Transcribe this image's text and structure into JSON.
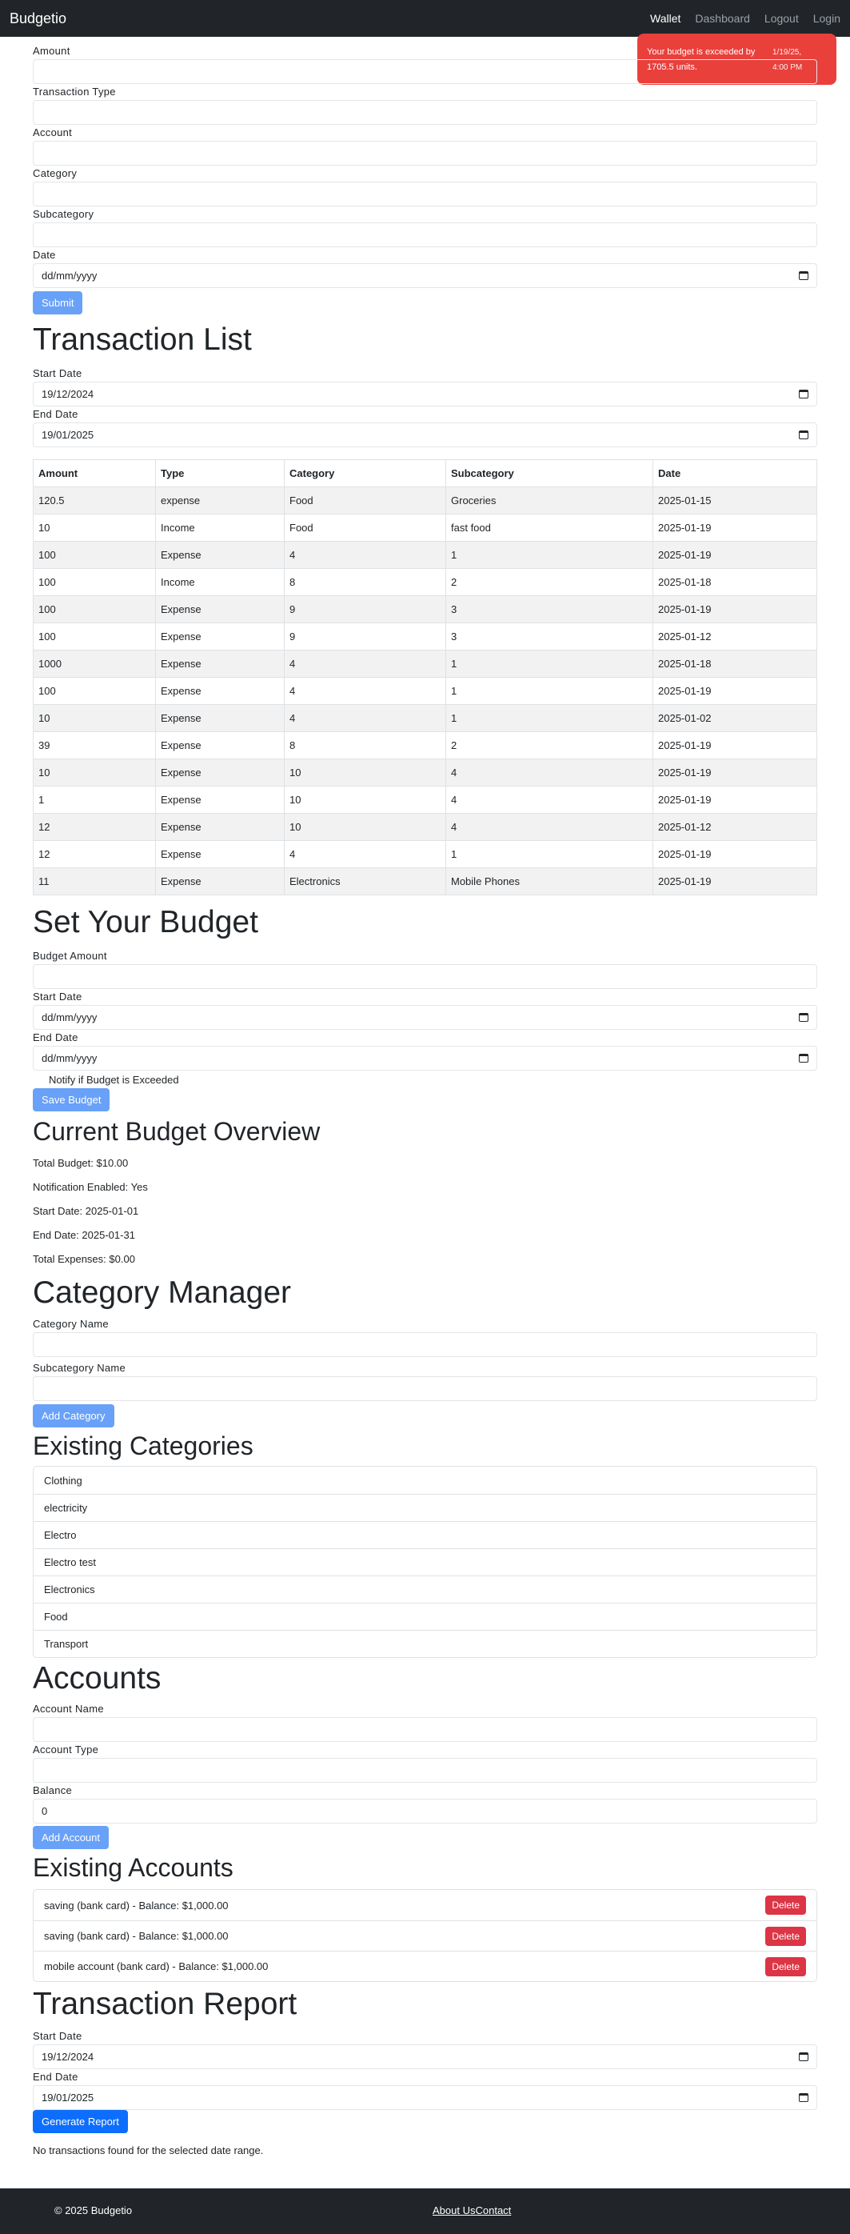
{
  "nav": {
    "brand": "Budgetio",
    "items": [
      "Wallet",
      "Dashboard",
      "Logout",
      "Login"
    ]
  },
  "toast": {
    "message": "Your budget is exceeded by 1705.5 units.",
    "time": "1/19/25, 4:00 PM"
  },
  "transaction_form": {
    "amount_label": "Amount",
    "type_label": "Transaction Type",
    "account_label": "Account",
    "category_label": "Category",
    "subcategory_label": "Subcategory",
    "date_label": "Date",
    "date_placeholder": "dd/mm/yyyy",
    "submit_label": "Submit"
  },
  "transaction_list": {
    "title": "Transaction List",
    "start_label": "Start Date",
    "start_value": "19/12/2024",
    "end_label": "End Date",
    "end_value": "19/01/2025",
    "headers": [
      "Amount",
      "Type",
      "Category",
      "Subcategory",
      "Date"
    ],
    "rows": [
      [
        "120.5",
        "expense",
        "Food",
        "Groceries",
        "2025-01-15"
      ],
      [
        "10",
        "Income",
        "Food",
        "fast food",
        "2025-01-19"
      ],
      [
        "100",
        "Expense",
        "4",
        "1",
        "2025-01-19"
      ],
      [
        "100",
        "Income",
        "8",
        "2",
        "2025-01-18"
      ],
      [
        "100",
        "Expense",
        "9",
        "3",
        "2025-01-19"
      ],
      [
        "100",
        "Expense",
        "9",
        "3",
        "2025-01-12"
      ],
      [
        "1000",
        "Expense",
        "4",
        "1",
        "2025-01-18"
      ],
      [
        "100",
        "Expense",
        "4",
        "1",
        "2025-01-19"
      ],
      [
        "10",
        "Expense",
        "4",
        "1",
        "2025-01-02"
      ],
      [
        "39",
        "Expense",
        "8",
        "2",
        "2025-01-19"
      ],
      [
        "10",
        "Expense",
        "10",
        "4",
        "2025-01-19"
      ],
      [
        "1",
        "Expense",
        "10",
        "4",
        "2025-01-19"
      ],
      [
        "12",
        "Expense",
        "10",
        "4",
        "2025-01-12"
      ],
      [
        "12",
        "Expense",
        "4",
        "1",
        "2025-01-19"
      ],
      [
        "11",
        "Expense",
        "Electronics",
        "Mobile Phones",
        "2025-01-19"
      ]
    ]
  },
  "budget": {
    "title": "Set Your Budget",
    "amount_label": "Budget Amount",
    "start_label": "Start Date",
    "end_label": "End Date",
    "date_placeholder": "dd/mm/yyyy",
    "notify_label": "Notify if Budget is Exceeded",
    "save_label": "Save Budget"
  },
  "overview": {
    "title": "Current Budget Overview",
    "lines": [
      "Total Budget: $10.00",
      "Notification Enabled: Yes",
      "Start Date: 2025-01-01",
      "End Date: 2025-01-31",
      "Total Expenses: $0.00"
    ]
  },
  "category_manager": {
    "title": "Category Manager",
    "name_label": "Category Name",
    "sub_label": "Subcategory Name",
    "add_label": "Add Category",
    "existing_title": "Existing Categories",
    "categories": [
      "Clothing",
      "electricity",
      "Electro",
      "Electro test",
      "Electronics",
      "Food",
      "Transport"
    ]
  },
  "accounts": {
    "title": "Accounts",
    "name_label": "Account Name",
    "type_label": "Account Type",
    "balance_label": "Balance",
    "balance_value": "0",
    "add_label": "Add Account",
    "existing_title": "Existing Accounts",
    "delete_label": "Delete",
    "items": [
      "saving (bank card) - Balance: $1,000.00",
      "saving (bank card) - Balance: $1,000.00",
      "mobile account (bank card) - Balance: $1,000.00"
    ]
  },
  "report": {
    "title": "Transaction Report",
    "start_label": "Start Date",
    "start_value": "19/12/2024",
    "end_label": "End Date",
    "end_value": "19/01/2025",
    "generate_label": "Generate Report",
    "empty_text": "No transactions found for the selected date range."
  },
  "footer": {
    "copyright": "© 2025 Budgetio",
    "about": "About Us",
    "contact": "Contact"
  },
  "colors": {
    "navbar": "#212529",
    "toast": "#e9403c",
    "button": "#68a1f7",
    "primary": "#0d6efd",
    "danger": "#dc3545"
  }
}
